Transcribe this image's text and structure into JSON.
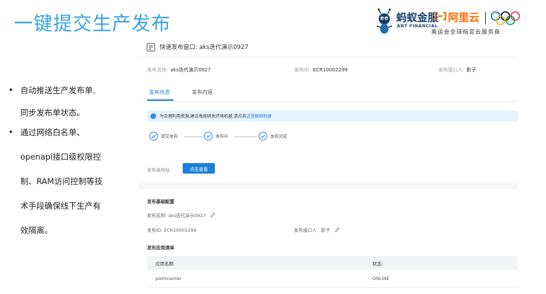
{
  "slide": {
    "title": "一键提交生产发布",
    "bullets": [
      {
        "lines": [
          "自动推送生产发布单,",
          "同步发布单状态。"
        ]
      },
      {
        "lines": [
          "通过网络白名单、",
          "openapi接口级权限控",
          "制、RAM访问控制等技",
          "术手段确保线下生产有",
          "效隔离。"
        ]
      }
    ]
  },
  "logos": {
    "ant_name": "蚂蚁金服",
    "ant_sub": "ANT FINANCIAL",
    "aliyun_name": "阿里云",
    "aliyun_sub": "奥运会全球指定云服务商"
  },
  "app": {
    "window_title": "快速发布窗口: aks迭代演示0927",
    "summary": {
      "name_label": "发布名称:",
      "name_value": "aks迭代演示0927",
      "id_label": "发布ID:",
      "id_value": "ECR10002299",
      "owner_label": "发布接口人:",
      "owner_value": "影子"
    },
    "tabs": [
      {
        "label": "发布信息",
        "active": true
      },
      {
        "label": "发布内容",
        "active": false
      }
    ],
    "info": {
      "text": "为合理利用资源,建议每周研发环境机器,请点击",
      "link": "这里解绑机器"
    },
    "steps": [
      "提交发布",
      "发布中",
      "发布完成"
    ],
    "url_label": "发布单地址:",
    "view_button": "点击查看",
    "basic": {
      "title": "发布基础配置",
      "name_label": "发布名称:",
      "name_value": "aks迭代演示0927",
      "id_label": "发布ID:",
      "id_value": "ECR10002299",
      "owner_label": "发布接口人",
      "owner_value": "影子"
    },
    "apps": {
      "title": "发布应用清单",
      "columns": [
        "应用名称",
        "状态:"
      ],
      "rows": [
        {
          "name": "pointcenter",
          "status": "ONLINE"
        }
      ]
    }
  },
  "colors": {
    "title_blue": "#3aa3e3",
    "accent": "#1d80d9",
    "ali_orange": "#ff6a00",
    "ant_navy": "#1a3f6c"
  }
}
